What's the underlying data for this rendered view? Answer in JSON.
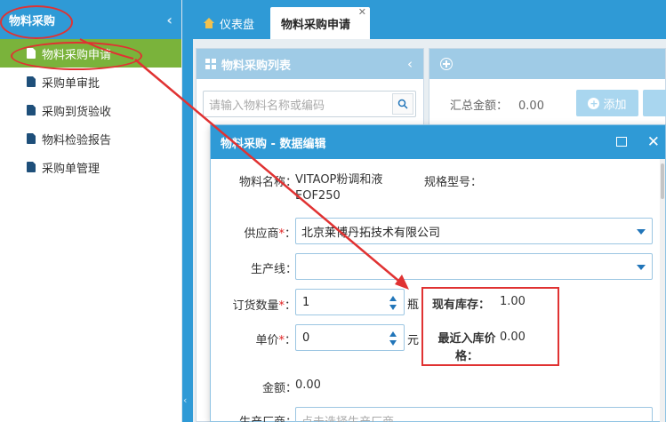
{
  "sidebar": {
    "title": "物料采购",
    "items": [
      {
        "label": "物料采购申请",
        "active": true
      },
      {
        "label": "采购单审批",
        "active": false
      },
      {
        "label": "采购到货验收",
        "active": false
      },
      {
        "label": "物料检验报告",
        "active": false
      },
      {
        "label": "采购单管理",
        "active": false
      }
    ]
  },
  "tabs": [
    {
      "label": "仪表盘",
      "icon": "home-icon"
    },
    {
      "label": "物料采购申请",
      "closable": true
    }
  ],
  "list_panel": {
    "title": "物料采购列表",
    "search_placeholder": "请输入物料名称或编码"
  },
  "detail_panel": {
    "summary_label": "汇总金额：",
    "summary_value": "0.00",
    "add_label": "添加"
  },
  "dialog": {
    "title": "物料采购 - 数据编辑",
    "material_name_label": "物料名称：",
    "material_name_value": "VITAOP粉调和液 EOF250",
    "spec_label": "规格型号：",
    "supplier_label": "供应商",
    "supplier_value": "北京莱博丹拓技术有限公司",
    "line_label": "生产线：",
    "line_value": "",
    "qty_label": "订货数量",
    "qty_value": "1",
    "qty_unit": "瓶",
    "price_label": "单价",
    "price_value": "0",
    "price_unit": "元",
    "stock_label": "现有库存：",
    "stock_value": "1.00",
    "recent_price_label": "最近入库价格：",
    "recent_price_value": "0.00",
    "amount_label": "金额：",
    "amount_value": "0.00",
    "maker_label": "生产厂商：",
    "maker_placeholder": "点击选择生产厂商"
  },
  "colors": {
    "primary": "#2f9ad6",
    "active_green": "#7ab33b",
    "annotation_red": "#e03232"
  }
}
